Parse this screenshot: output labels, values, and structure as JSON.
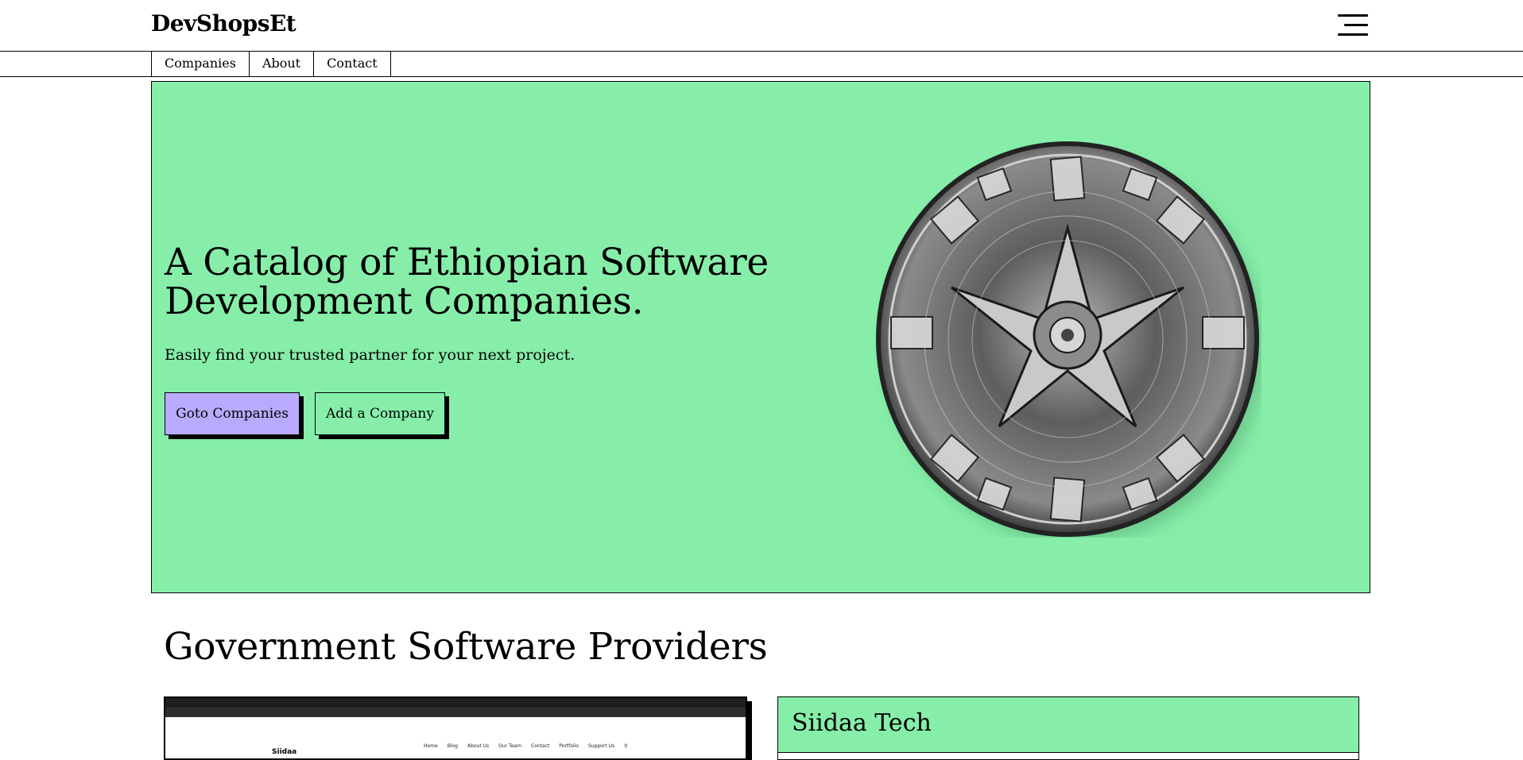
{
  "header": {
    "logo": "DevShopsEt",
    "menu_icon": "hamburger-menu-icon"
  },
  "nav": {
    "items": [
      "Companies",
      "About",
      "Contact"
    ]
  },
  "hero": {
    "title": "A Catalog of Ethiopian Software Development Companies.",
    "subtitle": "Easily find your trusted partner for your next project.",
    "primary_button": "Goto Companies",
    "secondary_button": "Add a Company",
    "image": "ethiopian-silver-shield-image",
    "background_color": "#86eea9",
    "primary_button_color": "#b9aaff"
  },
  "section": {
    "title": "Government Software Providers"
  },
  "preview": {
    "site_logo": "Siidaa",
    "nav": [
      "Home",
      "Blog",
      "About Us",
      "Our Team",
      "Contact",
      "Portfolio",
      "Support Us"
    ]
  },
  "card": {
    "title": "Siidaa Tech"
  }
}
